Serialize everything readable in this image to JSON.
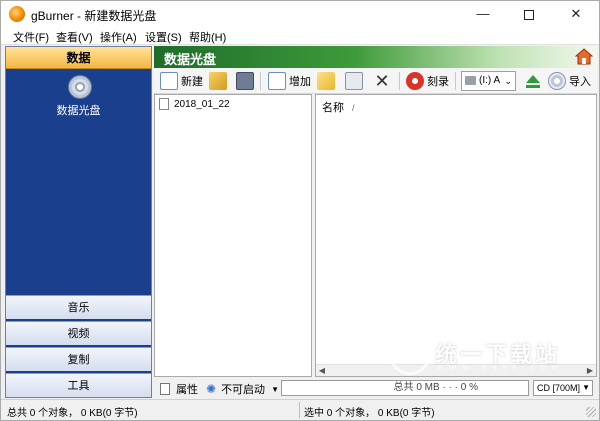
{
  "window": {
    "title": "gBurner - 新建数据光盘"
  },
  "menu": {
    "items": [
      "文件(F)",
      "查看(V)",
      "操作(A)",
      "设置(S)",
      "帮助(H)"
    ]
  },
  "left_panel": {
    "header": "数据",
    "item_label": "数据光盘",
    "tabs": [
      "音乐",
      "视频",
      "复制",
      "工具"
    ]
  },
  "right": {
    "title": "数据光盘",
    "toolbar": {
      "new_label": "新建",
      "add_label": "增加",
      "burn_label": "刻录",
      "drive": "(I:) A",
      "import_label": "导入"
    },
    "tree": {
      "items": [
        "2018_01_22"
      ]
    },
    "list": {
      "column_name": "名称",
      "sort_indicator": "/"
    },
    "bottom": {
      "properties_label": "属性",
      "boot_label": "不可启动",
      "capacity_text": "总共 0 MB · · · 0 %",
      "media": "CD [700M]"
    }
  },
  "status": {
    "left": "总共 0 个对象， 0 KB(0 字节)",
    "right": "选中 0 个对象， 0 KB(0 字节)"
  },
  "watermark": {
    "text": "统一下载站",
    "sub": "W W W . 3 9 9 3 . C O M"
  },
  "colors": {
    "left_panel_bg": "#1a3f8c",
    "header_green": "#3e9a3a",
    "tab_highlight": "#f4b642"
  }
}
